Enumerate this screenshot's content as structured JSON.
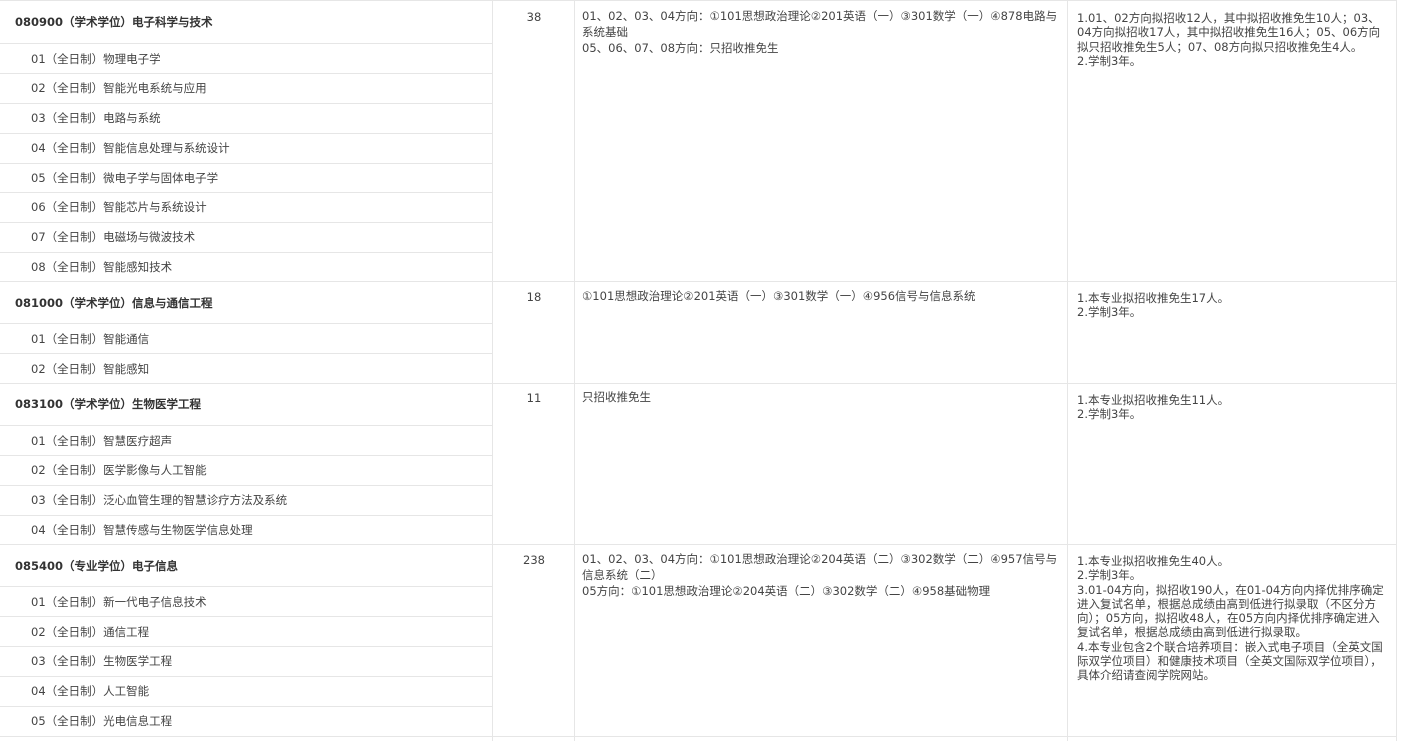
{
  "majors": [
    {
      "title": "080900（学术学位）电子科学与技术",
      "quota": "38",
      "exam": [
        "01、02、03、04方向：①101思想政治理论②201英语（一）③301数学（一）④878电路与系统基础",
        "05、06、07、08方向：只招收推免生"
      ],
      "notes": [
        "1.01、02方向拟招收12人，其中拟招收推免生10人；03、04方向拟招收17人，其中拟招收推免生16人；05、06方向拟只招收推免生5人；07、08方向拟只招收推免生4人。",
        "2.学制3年。"
      ],
      "directions": [
        "01（全日制）物理电子学",
        "02（全日制）智能光电系统与应用",
        "03（全日制）电路与系统",
        "04（全日制）智能信息处理与系统设计",
        "05（全日制）微电子学与固体电子学",
        "06（全日制）智能芯片与系统设计",
        "07（全日制）电磁场与微波技术",
        "08（全日制）智能感知技术"
      ]
    },
    {
      "title": "081000（学术学位）信息与通信工程",
      "quota": "18",
      "exam": [
        "①101思想政治理论②201英语（一）③301数学（一）④956信号与信息系统"
      ],
      "notes": [
        "1.本专业拟招收推免生17人。",
        "2.学制3年。"
      ],
      "directions": [
        "01（全日制）智能通信",
        "02（全日制）智能感知"
      ]
    },
    {
      "title": "083100（学术学位）生物医学工程",
      "quota": "11",
      "exam": [
        "只招收推免生"
      ],
      "notes": [
        "1.本专业拟招收推免生11人。",
        "2.学制3年。"
      ],
      "directions": [
        "01（全日制）智慧医疗超声",
        "02（全日制）医学影像与人工智能",
        "03（全日制）泛心血管生理的智慧诊疗方法及系统",
        "04（全日制）智慧传感与生物医学信息处理"
      ]
    },
    {
      "title": "085400（专业学位）电子信息",
      "quota": "238",
      "exam": [
        "01、02、03、04方向：①101思想政治理论②204英语（二）③302数学（二）④957信号与信息系统（二）",
        "05方向：①101思想政治理论②204英语（二）③302数学（二）④958基础物理"
      ],
      "notes": [
        "1.本专业拟招收推免生40人。",
        "2.学制3年。",
        "3.01-04方向，拟招收190人，在01-04方向内择优排序确定进入复试名单，根据总成绩由高到低进行拟录取（不区分方向）；05方向，拟招收48人，在05方向内择优排序确定进入复试名单，根据总成绩由高到低进行拟录取。",
        "4.本专业包含2个联合培养项目：嵌入式电子项目（全英文国际双学位项目）和健康技术项目（全英文国际双学位项目），具体介绍请查阅学院网站。"
      ],
      "directions": [
        "01（全日制）新一代电子信息技术",
        "02（全日制）通信工程",
        "03（全日制）生物医学工程",
        "04（全日制）人工智能",
        "05（全日制）光电信息工程"
      ]
    }
  ]
}
